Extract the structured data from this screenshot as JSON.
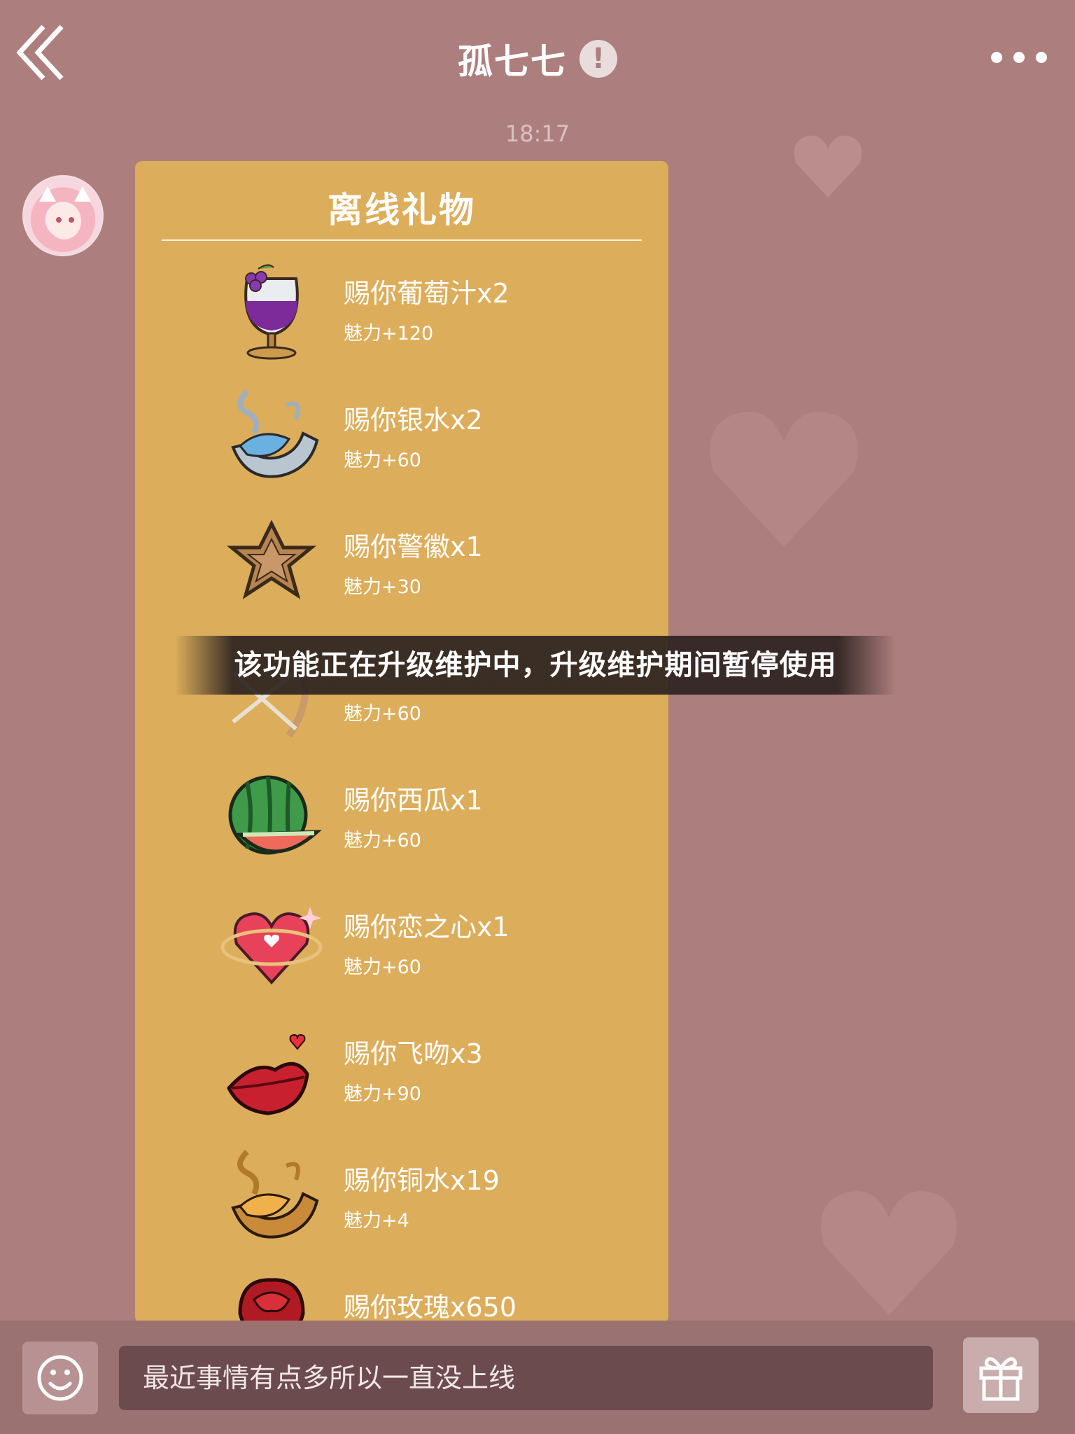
{
  "header": {
    "back_icon": "chevron-double-left-icon",
    "title": "孤七七",
    "warning_icon": "exclamation-circle-icon",
    "warning_glyph": "!",
    "more_icon": "ellipsis-icon"
  },
  "timestamp": "18:17",
  "card": {
    "title": "离线礼物",
    "gifts": [
      {
        "name": "赐你葡萄汁x2",
        "charm": "魅力+120",
        "icon": "grape-juice-goblet-icon"
      },
      {
        "name": "赐你银水x2",
        "charm": "魅力+60",
        "icon": "silver-water-icon"
      },
      {
        "name": "赐你警徽x1",
        "charm": "魅力+30",
        "icon": "police-badge-icon"
      },
      {
        "name": "",
        "charm": "魅力+60",
        "icon": "cupid-bow-arrow-icon"
      },
      {
        "name": "赐你西瓜x1",
        "charm": "魅力+60",
        "icon": "watermelon-icon"
      },
      {
        "name": "赐你恋之心x1",
        "charm": "魅力+60",
        "icon": "love-heart-gem-icon"
      },
      {
        "name": "赐你飞吻x3",
        "charm": "魅力+90",
        "icon": "kiss-lips-icon"
      },
      {
        "name": "赐你铜水x19",
        "charm": "魅力+4",
        "icon": "copper-water-icon"
      },
      {
        "name": "赐你玫瑰x650",
        "charm": "",
        "icon": "rose-icon"
      }
    ]
  },
  "toast": "该功能正在升级维护中，升级维护期间暂停使用",
  "bottom_bar": {
    "emoji_icon": "smiley-face-icon",
    "input_value": "最近事情有点多所以一直没上线",
    "gift_icon": "gift-box-icon"
  },
  "colors": {
    "background": "#ad7e7e",
    "card": "#dcad5b",
    "input": "#6b4b4e",
    "bottom_bar": "#9b7272"
  }
}
